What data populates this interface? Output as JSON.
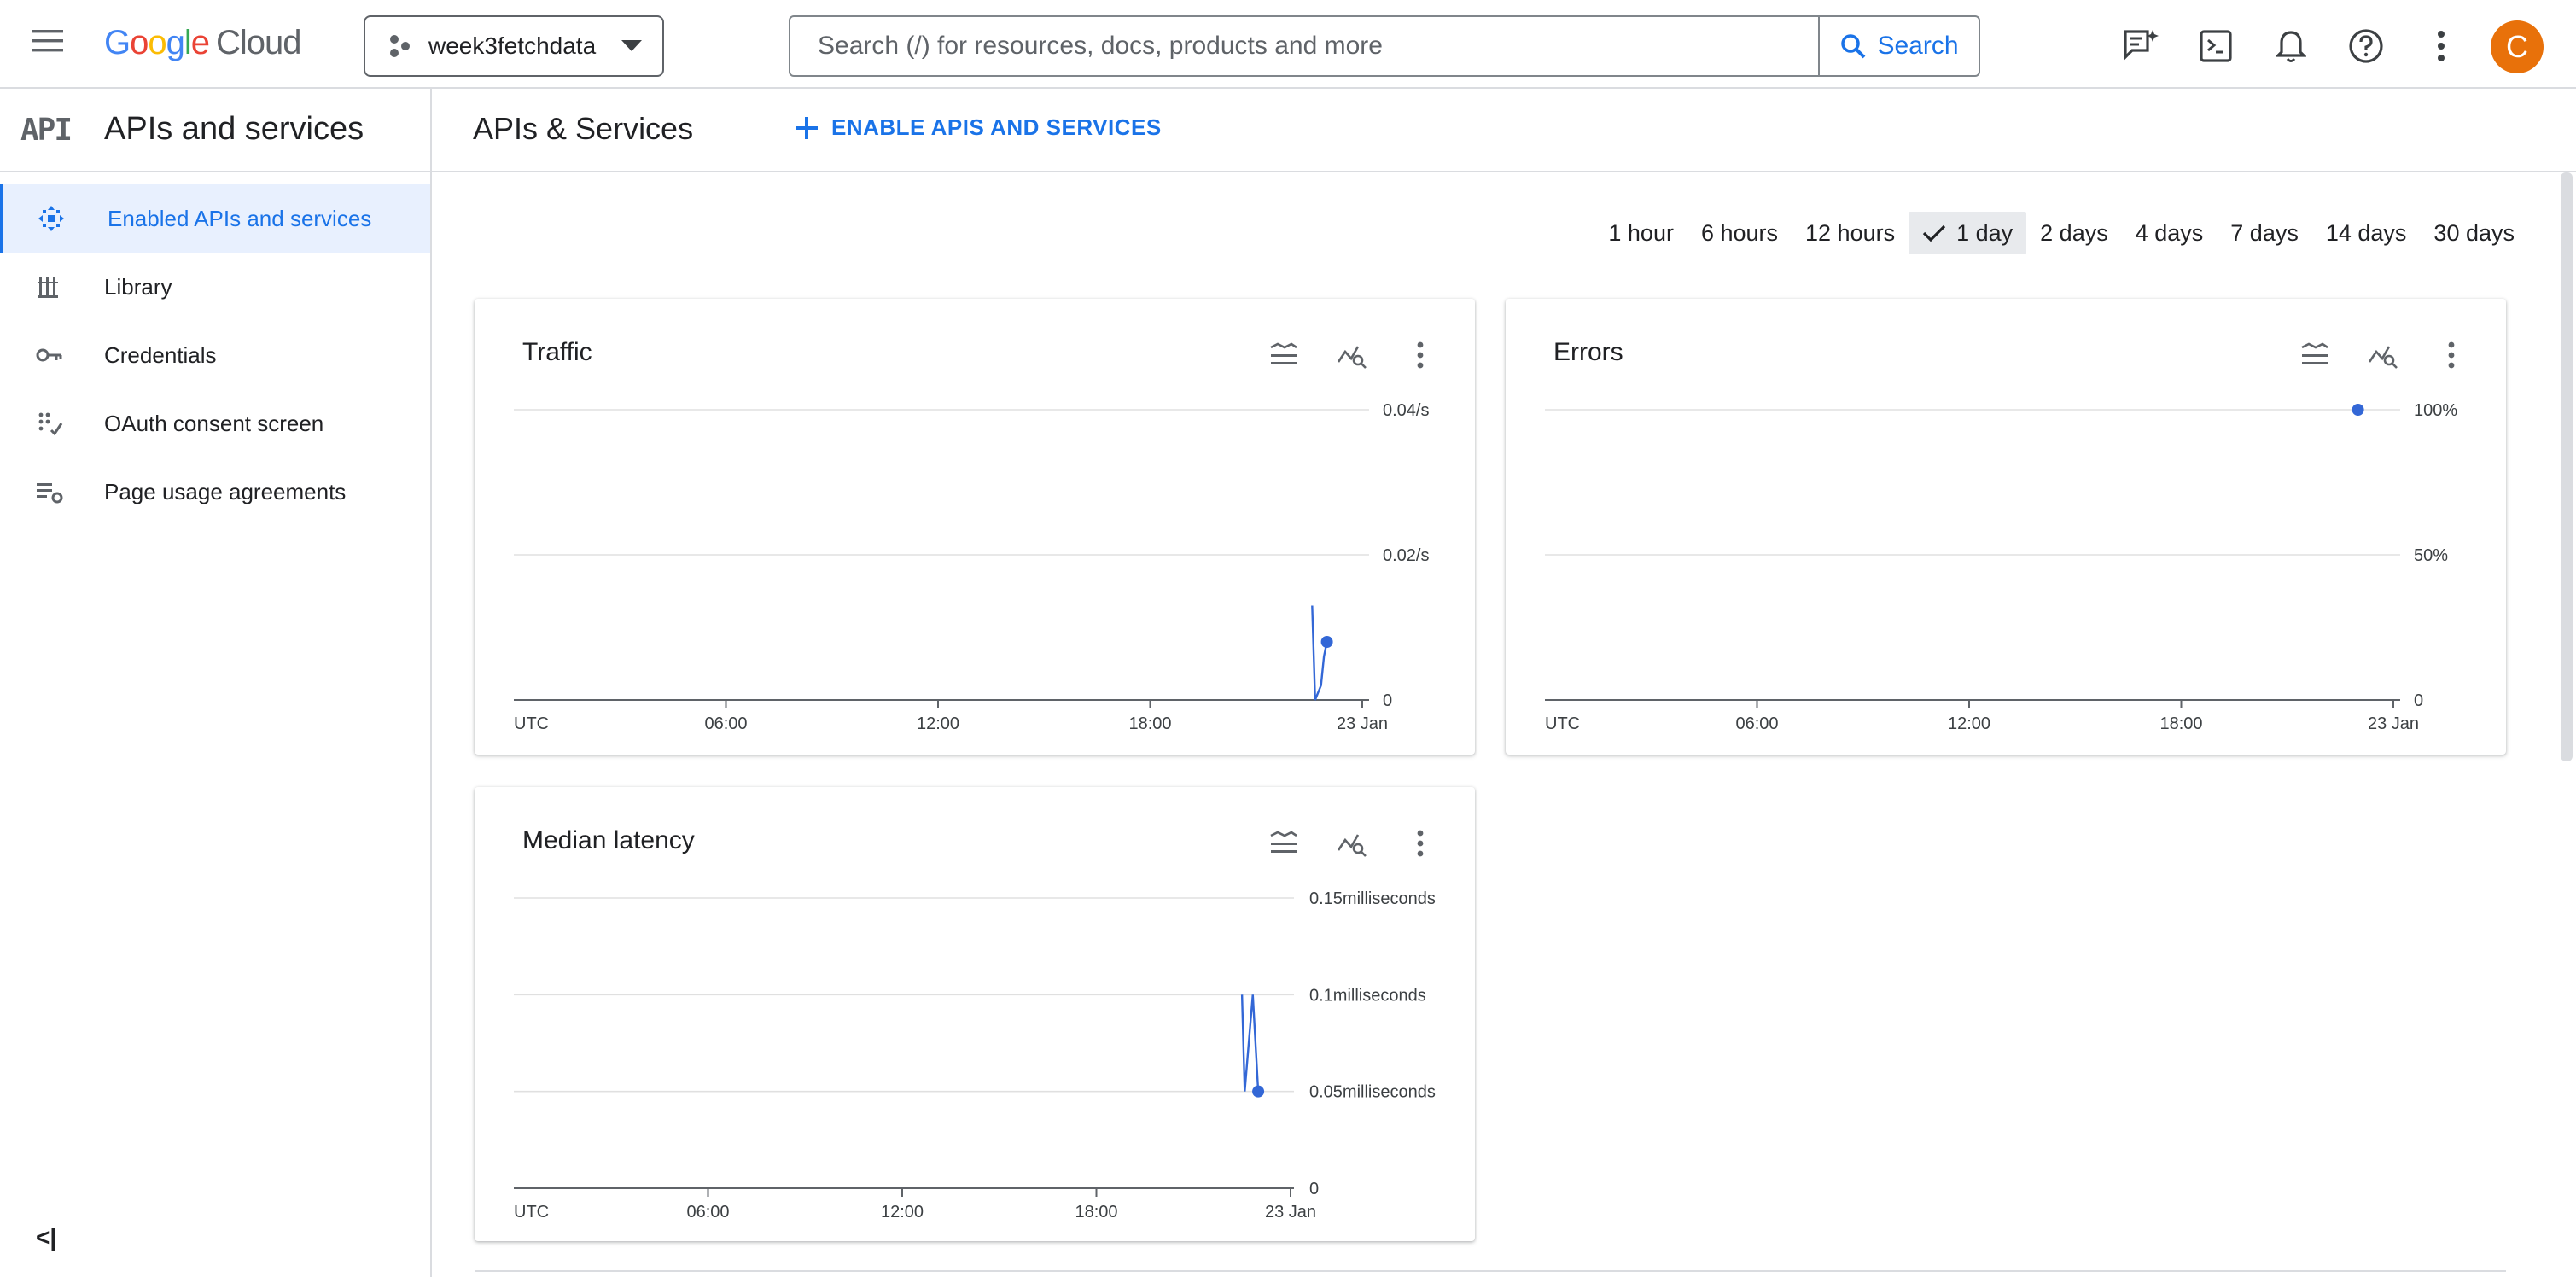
{
  "header": {
    "logo_google": "Google",
    "logo_cloud": "Cloud",
    "project_name": "week3fetchdata",
    "search_placeholder": "Search (/) for resources, docs, products and more",
    "search_button": "Search",
    "avatar_letter": "C",
    "icons": [
      "menu-icon",
      "feedback-icon",
      "cloud-shell-icon",
      "notifications-icon",
      "help-icon",
      "more-vert-icon"
    ]
  },
  "sidebar": {
    "api_badge": "API",
    "title": "APIs and services",
    "items": [
      {
        "label": "Enabled APIs and services",
        "icon": "enabled-apis-icon",
        "active": true
      },
      {
        "label": "Library",
        "icon": "library-icon",
        "active": false
      },
      {
        "label": "Credentials",
        "icon": "key-icon",
        "active": false
      },
      {
        "label": "OAuth consent screen",
        "icon": "oauth-icon",
        "active": false
      },
      {
        "label": "Page usage agreements",
        "icon": "page-usage-icon",
        "active": false
      }
    ],
    "collapse_label": "<|"
  },
  "main": {
    "title": "APIs & Services",
    "enable_button": "ENABLE APIS AND SERVICES",
    "time_ranges": [
      "1 hour",
      "6 hours",
      "12 hours",
      "1 day",
      "2 days",
      "4 days",
      "7 days",
      "14 days",
      "30 days"
    ],
    "selected_range": "1 day"
  },
  "colors": {
    "accent": "#1a73e8",
    "series": "#3367d6",
    "avatar": "#e8710a"
  },
  "chart_data": [
    {
      "type": "line",
      "title": "Traffic",
      "x_ticks": [
        "UTC",
        "06:00",
        "12:00",
        "18:00",
        "23 Jan"
      ],
      "y_ticks": [
        "0",
        "0.02/s",
        "0.04/s"
      ],
      "ylim": [
        0,
        0.04
      ],
      "series": [
        {
          "x": [
            "22:35",
            "22:40",
            "22:50",
            "22:55",
            "23:00"
          ],
          "y": [
            0.013,
            0,
            0.002,
            0.006,
            0.008
          ]
        }
      ],
      "grid": true
    },
    {
      "type": "line",
      "title": "Errors",
      "x_ticks": [
        "UTC",
        "06:00",
        "12:00",
        "18:00",
        "23 Jan"
      ],
      "y_ticks": [
        "0",
        "50%",
        "100%"
      ],
      "ylim": [
        0,
        100
      ],
      "series": [
        {
          "x": [
            "23:00"
          ],
          "y": [
            100
          ]
        }
      ],
      "grid": true
    },
    {
      "type": "line",
      "title": "Median latency",
      "x_ticks": [
        "UTC",
        "06:00",
        "12:00",
        "18:00",
        "23 Jan"
      ],
      "y_ticks": [
        "0",
        "0.05milliseconds",
        "0.1milliseconds",
        "0.15milliseconds"
      ],
      "ylim": [
        0,
        0.15
      ],
      "series": [
        {
          "x": [
            "22:30",
            "22:35",
            "22:50",
            "23:00"
          ],
          "y": [
            0.1,
            0.05,
            0.1,
            0.05
          ]
        }
      ],
      "grid": true
    }
  ]
}
